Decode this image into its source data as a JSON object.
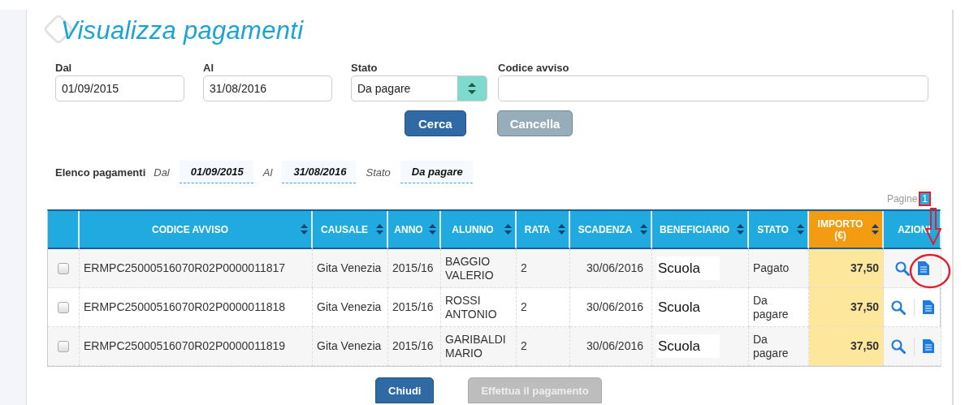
{
  "title": "Visualizza pagamenti",
  "filters": [
    {
      "label": "Dal",
      "value": "01/09/2015",
      "kind": "text"
    },
    {
      "label": "Al",
      "value": "31/08/2016",
      "kind": "text"
    },
    {
      "label": "Stato",
      "value": "Da pagare",
      "kind": "select"
    },
    {
      "label": "Codice avviso",
      "kind": "wide"
    }
  ],
  "buttons": [
    {
      "label": "Cerca",
      "kind": "primary"
    },
    {
      "label": "Cancella",
      "kind": "secondary"
    }
  ],
  "summary": {
    "title": "Elenco pagamenti",
    "items": [
      {
        "label": "Dal",
        "value": "01/09/2015"
      },
      {
        "label": "Al",
        "value": "31/08/2016"
      },
      {
        "label": "Stato",
        "value": "Da pagare"
      }
    ]
  },
  "pagination": {
    "label": "Pagine",
    "pages": [
      {
        "label": "1",
        "selected": true
      }
    ]
  },
  "table": {
    "columns": [
      {
        "label": "CODICE AVVISO",
        "kind": "text",
        "sortable": true
      },
      {
        "label": "CAUSALE",
        "kind": "text",
        "sortable": true
      },
      {
        "label": "ANNO",
        "kind": "text",
        "sortable": true
      },
      {
        "label": "ALUNNO",
        "kind": "text",
        "sortable": true
      },
      {
        "label": "RATA",
        "kind": "text",
        "sortable": true
      },
      {
        "label": "SCADENZA",
        "kind": "date",
        "sortable": true
      },
      {
        "label": "BENEFICIARIO",
        "kind": "masked",
        "sortable": true
      },
      {
        "label": "STATO",
        "kind": "text",
        "sortable": true
      },
      {
        "label": "IMPORTO (€)",
        "kind": "amount",
        "sortable": true
      },
      {
        "label": "AZIONI",
        "kind": "actions",
        "sortable": false
      }
    ],
    "rows": [
      {
        "checked": false,
        "cells": [
          "ERMPC25000516070R02P0000011817",
          "Gita Venezia",
          "2015/16",
          "BAGGIO VALERIO",
          "2",
          "30/06/2016",
          "Scuola",
          "Pagato",
          "37,50"
        ]
      },
      {
        "checked": false,
        "cells": [
          "ERMPC25000516070R02P0000011818",
          "Gita Venezia",
          "2015/16",
          "ROSSI ANTONIO",
          "2",
          "30/06/2016",
          "Scuola",
          "Da pagare",
          "37,50"
        ]
      },
      {
        "checked": false,
        "cells": [
          "ERMPC25000516070R02P0000011819",
          "Gita Venezia",
          "2015/16",
          "GARIBALDI MARIO",
          "2",
          "30/06/2016",
          "Scuola",
          "Da pagare",
          "37,50"
        ]
      }
    ]
  },
  "footer_buttons": [
    {
      "label": "Chiudi",
      "disabled": false
    },
    {
      "label": "Effettua il pagamento",
      "disabled": true
    }
  ]
}
